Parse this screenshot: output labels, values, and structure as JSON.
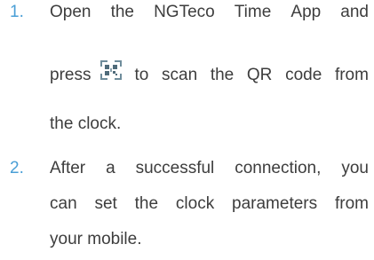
{
  "steps": [
    {
      "number": "1.",
      "line1": [
        "Open",
        "the",
        "NGTeco",
        "Time",
        "App",
        "and"
      ],
      "line2_before_icon": "press",
      "icon": "qr-scan-icon",
      "line2_after_icon": [
        "to",
        "scan",
        "the",
        "QR",
        "code",
        "from"
      ],
      "line3": "the clock."
    },
    {
      "number": "2.",
      "line1": [
        "After",
        "a",
        "successful",
        "connection,",
        "you"
      ],
      "line2": [
        "can",
        "set",
        "the",
        "clock",
        "parameters",
        "from"
      ],
      "line3": "your mobile."
    }
  ],
  "colors": {
    "number": "#4a9fd6",
    "text": "#3d3d3d",
    "icon": "#5c7b8c"
  }
}
